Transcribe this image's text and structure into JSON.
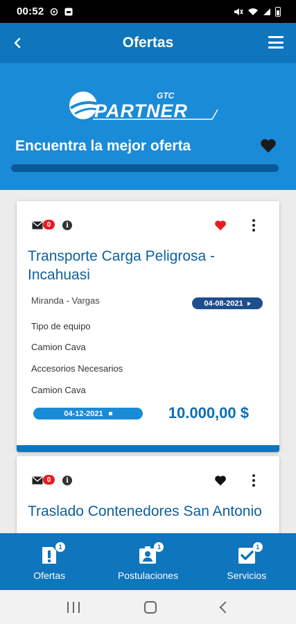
{
  "status_bar": {
    "time": "00:52"
  },
  "app_bar": {
    "title": "Ofertas"
  },
  "banner": {
    "logo_small": "GTC",
    "logo_big": "PARTNER",
    "headline": "Encuentra la mejor oferta"
  },
  "offers": [
    {
      "message_count": "0",
      "title": "Transporte Carga Peligrosa - Incahuasi",
      "route": "Miranda - Vargas",
      "start_date": "04-08-2021",
      "equipment_label": "Tipo de equipo",
      "equipment_value": "Camion Cava",
      "accessories_label": "Accesorios Necesarios",
      "accessories_value": "Camion Cava",
      "end_date": "04-12-2021",
      "price": "10.000,00 $",
      "favorite": true,
      "heart_color": "#e61c23"
    },
    {
      "message_count": "0",
      "title": "Traslado Contenedores San Antonio",
      "favorite": false,
      "heart_color": "#111111"
    }
  ],
  "bottom_nav": [
    {
      "label": "Ofertas",
      "badge": "1",
      "icon": "alert-doc-icon"
    },
    {
      "label": "Postulaciones",
      "badge": "1",
      "icon": "person-badge-icon"
    },
    {
      "label": "Servicios",
      "badge": "1",
      "icon": "checklist-icon"
    }
  ],
  "colors": {
    "primary": "#0f75bc",
    "banner": "#1a8bd6",
    "accent_red": "#e61c23",
    "title_blue": "#0d5f9d"
  }
}
